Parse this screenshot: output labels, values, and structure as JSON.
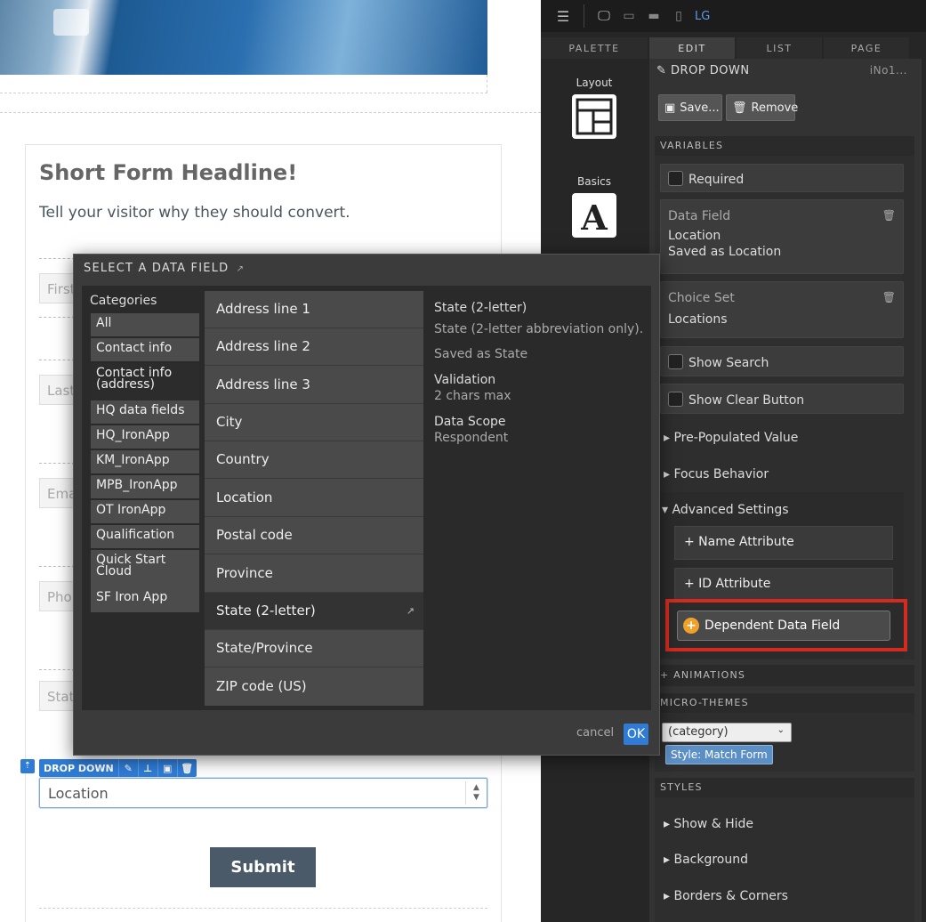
{
  "canvas": {
    "headline": "Short Form Headline!",
    "subheadline": "Tell your visitor why they should convert.",
    "ghost_fields": [
      "First",
      "Last",
      "Ema",
      "Pho",
      "Stat"
    ],
    "dropdown_toolbar_label": "DROP DOWN",
    "dropdown_value": "Location",
    "submit_label": "Submit"
  },
  "panel": {
    "device_label": "LG",
    "tabs": [
      "PALETTE",
      "EDIT",
      "LIST",
      "PAGE"
    ],
    "palette": [
      {
        "label": "Layout",
        "icon": "layout-icon"
      },
      {
        "label": "Basics",
        "icon": "text-icon"
      }
    ],
    "edit": {
      "title": "DROP DOWN",
      "id_label": "iNo1...",
      "save_label": "Save...",
      "remove_label": "Remove",
      "variables_head": "VARIABLES",
      "required_label": "Required",
      "data_field_label": "Data Field",
      "data_field_value": "Location",
      "data_field_saved": "Saved as Location",
      "choice_set_label": "Choice Set",
      "choice_set_value": "Locations",
      "show_search_label": "Show Search",
      "show_clear_label": "Show Clear Button",
      "prepopulated_label": "Pre-Populated Value",
      "focus_label": "Focus Behavior",
      "advanced_label": "Advanced Settings",
      "name_attr_label": "+ Name Attribute",
      "id_attr_label": "+ ID Attribute",
      "dependent_label": "Dependent Data Field",
      "animations_head": "ANIMATIONS",
      "micro_themes_head": "MICRO-THEMES",
      "category_select": "(category)",
      "style_badge": "Style: Match Form",
      "styles_head": "STYLES",
      "show_hide_label": "Show & Hide",
      "background_label": "Background",
      "borders_label": "Borders & Corners"
    }
  },
  "modal": {
    "title": "SELECT A DATA FIELD",
    "categories_title": "Categories",
    "categories": [
      "All",
      "Contact info",
      "Contact info (address)",
      "HQ data fields",
      "HQ_IronApp",
      "KM_IronApp",
      "MPB_IronApp",
      "OT IronApp",
      "Qualification",
      "Quick Start Cloud",
      "SF Iron App"
    ],
    "fields": [
      "Address line 1",
      "Address line 2",
      "Address line 3",
      "City",
      "Country",
      "Location",
      "Postal code",
      "Province",
      "State (2-letter)",
      "State/Province",
      "ZIP code (US)"
    ],
    "detail": {
      "name": "State (2-letter)",
      "description": "State (2-letter abbreviation only).",
      "saved_as": "Saved as State",
      "validation_label": "Validation",
      "validation_value": "2 chars max",
      "scope_label": "Data Scope",
      "scope_value": "Respondent"
    },
    "cancel_label": "cancel",
    "ok_label": "OK"
  }
}
